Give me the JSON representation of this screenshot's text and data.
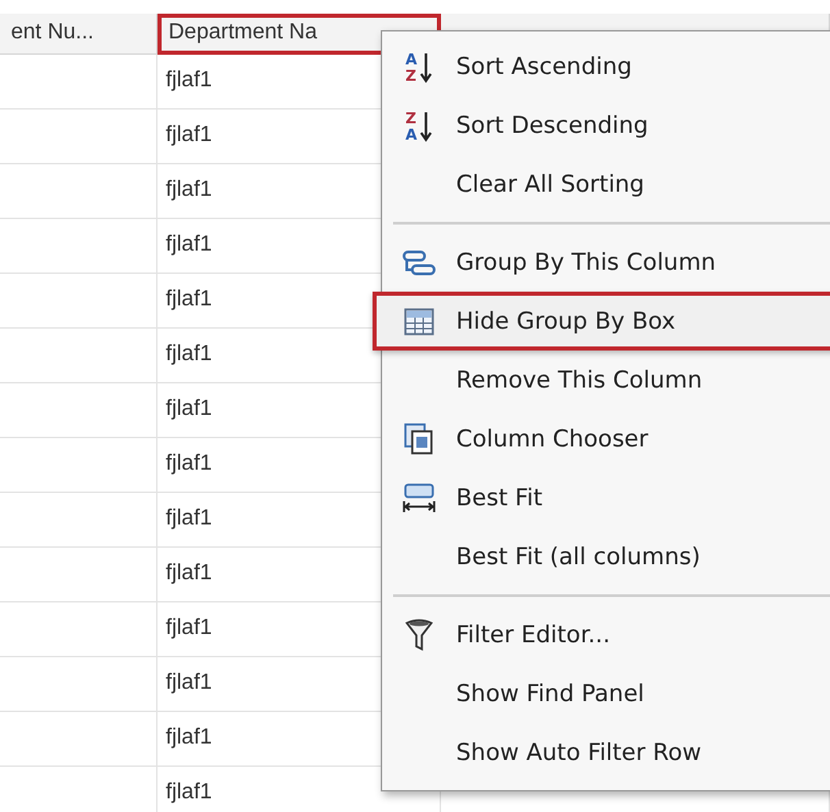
{
  "grid": {
    "columns": [
      {
        "label": "ent Nu...",
        "highlighted": false
      },
      {
        "label": "Department Na",
        "highlighted": true
      }
    ],
    "rows": [
      {
        "department_name": "fjlaf1"
      },
      {
        "department_name": "fjlaf1"
      },
      {
        "department_name": "fjlaf1"
      },
      {
        "department_name": "fjlaf1"
      },
      {
        "department_name": "fjlaf1"
      },
      {
        "department_name": "fjlaf1"
      },
      {
        "department_name": "fjlaf1"
      },
      {
        "department_name": "fjlaf1"
      },
      {
        "department_name": "fjlaf1"
      },
      {
        "department_name": "fjlaf1"
      },
      {
        "department_name": "fjlaf1"
      },
      {
        "department_name": "fjlaf1"
      },
      {
        "department_name": "fjlaf1"
      },
      {
        "department_name": "fjlaf1"
      }
    ]
  },
  "context_menu": {
    "sections": [
      [
        {
          "label": "Sort Ascending",
          "kind": "sort",
          "icon_letters": [
            "A",
            "Z"
          ],
          "highlighted": false
        },
        {
          "label": "Sort Descending",
          "kind": "sort",
          "icon_letters": [
            "Z",
            "A"
          ],
          "highlighted": false
        },
        {
          "label": "Clear All Sorting",
          "kind": "plain",
          "highlighted": false
        }
      ],
      [
        {
          "label": "Group By This Column",
          "kind": "group",
          "highlighted": false
        },
        {
          "label": "Hide Group By Box",
          "kind": "groupbox",
          "highlighted": true
        },
        {
          "label": "Remove This Column",
          "kind": "plain",
          "highlighted": false
        },
        {
          "label": "Column Chooser",
          "kind": "chooser",
          "highlighted": false
        },
        {
          "label": "Best Fit",
          "kind": "fit",
          "highlighted": false
        },
        {
          "label": "Best Fit (all columns)",
          "kind": "plain",
          "highlighted": false
        }
      ],
      [
        {
          "label": "Filter Editor...",
          "kind": "filter",
          "highlighted": false
        },
        {
          "label": "Show Find Panel",
          "kind": "plain",
          "highlighted": false
        },
        {
          "label": "Show Auto Filter Row",
          "kind": "plain",
          "highlighted": false
        }
      ]
    ]
  }
}
